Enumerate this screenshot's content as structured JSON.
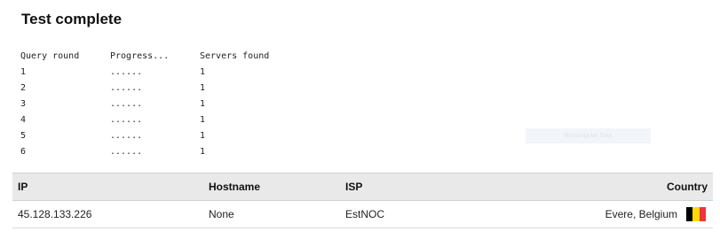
{
  "title": "Test complete",
  "query_table": {
    "headers": [
      "Query round",
      "Progress...",
      "Servers found"
    ],
    "rows": [
      [
        "1",
        "......",
        "1"
      ],
      [
        "2",
        "......",
        "1"
      ],
      [
        "3",
        "......",
        "1"
      ],
      [
        "4",
        "......",
        "1"
      ],
      [
        "5",
        "......",
        "1"
      ],
      [
        "6",
        "......",
        "1"
      ]
    ]
  },
  "overlay_label": "Rectangular Snip",
  "results_table": {
    "headers": [
      "IP",
      "Hostname",
      "ISP",
      "Country"
    ],
    "rows": [
      {
        "ip": "45.128.133.226",
        "hostname": "None",
        "isp": "EstNOC",
        "country": "Evere, Belgium",
        "flag_icon": "belgium-flag-icon",
        "flag_colors": [
          "#000000",
          "#FFD90C",
          "#EF3340"
        ]
      }
    ]
  }
}
